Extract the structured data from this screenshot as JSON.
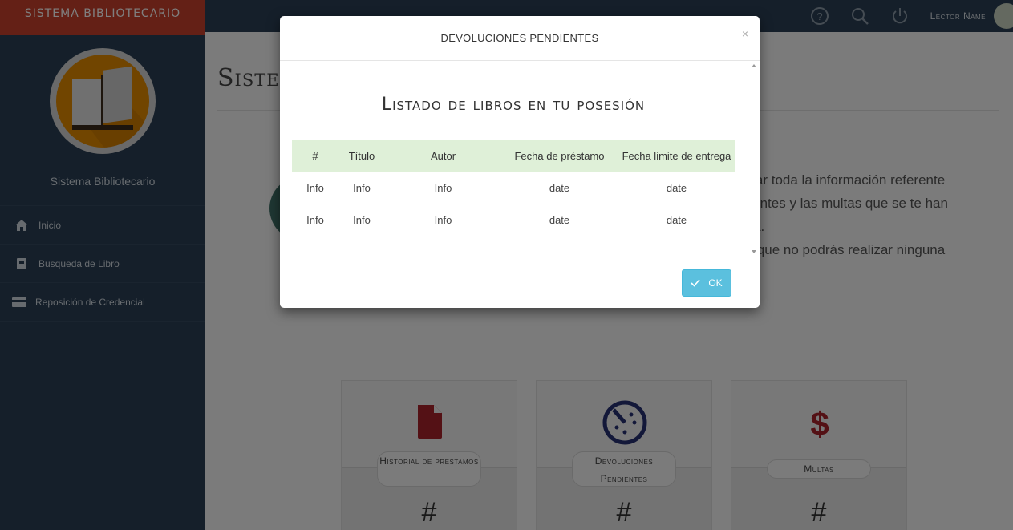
{
  "sidebar": {
    "brand": "SISTEMA BIBLIOTECARIO",
    "profile_name": "Sistema Bibliotecario",
    "items": [
      {
        "label": "Inicio",
        "icon": "home-icon"
      },
      {
        "label": "Busqueda de Libro",
        "icon": "book-search-icon"
      },
      {
        "label": "Reposición de Credencial",
        "icon": "credit-card-icon"
      }
    ]
  },
  "topbar": {
    "user_name": "Lector Name",
    "icons": [
      "help-icon",
      "search-icon",
      "power-icon"
    ]
  },
  "main": {
    "title": "Sistem",
    "info_lines": [
      "nsultar toda la información referente",
      "endientes y las multas que se te han",
      "ácora.",
      "or lo que no podrás realizar ninguna"
    ],
    "cards": [
      {
        "label": "Historial de prestamos",
        "count": "#",
        "icon": "file-icon",
        "color": "#a8222b"
      },
      {
        "label": "Devoluciones Pendientes",
        "count": "#",
        "icon": "timer-icon",
        "color": "#263173"
      },
      {
        "label": "Multas",
        "count": "#",
        "icon": "dollar-icon",
        "color": "#a8222b"
      }
    ]
  },
  "modal": {
    "title": "DEVOLUCIONES PENDIENTES",
    "close": "×",
    "list_title": "Listado de libros en tu posesión",
    "columns": [
      "#",
      "Título",
      "Autor",
      "Fecha de préstamo",
      "Fecha limite de entrega"
    ],
    "rows": [
      [
        "Info",
        "Info",
        "Info",
        "date",
        "date"
      ],
      [
        "Info",
        "Info",
        "Info",
        "date",
        "date"
      ]
    ],
    "ok_label": "OK"
  }
}
